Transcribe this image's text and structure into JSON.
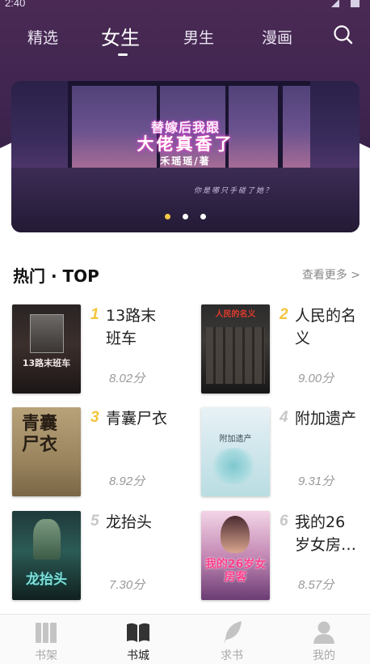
{
  "status_bar": {
    "time": "2:40"
  },
  "top_nav": {
    "tabs": [
      {
        "label": "精选",
        "active": false
      },
      {
        "label": "女生",
        "active": true
      },
      {
        "label": "男生",
        "active": false
      },
      {
        "label": "漫画",
        "active": false
      }
    ],
    "search_icon": "search-icon"
  },
  "banner": {
    "title_line1": "替嫁后我跟",
    "title_line2": "大佬真香了",
    "author": "禾瑶瑶/著",
    "subtitle": "你是哪只手碰了她？",
    "dots_total": 3,
    "dots_active_index": 0
  },
  "section": {
    "title": "热门 · TOP",
    "more": "查看更多 >"
  },
  "books": [
    {
      "rank": "1",
      "title": "13路末班车",
      "score": "8.02分",
      "cover_text": "13路末班车"
    },
    {
      "rank": "2",
      "title": "人民的名义",
      "score": "9.00分",
      "cover_text": "人民的名义"
    },
    {
      "rank": "3",
      "title": "青囊尸衣",
      "score": "8.92分",
      "cover_text": "青囊尸衣"
    },
    {
      "rank": "4",
      "title": "附加遗产",
      "score": "9.31分",
      "cover_text": "附加遗产"
    },
    {
      "rank": "5",
      "title": "龙抬头",
      "score": "7.30分",
      "cover_text": "龙抬头"
    },
    {
      "rank": "6",
      "title": "我的26岁女房…",
      "score": "8.57分",
      "cover_text": "我的26岁女房客"
    }
  ],
  "bottom_nav": [
    {
      "label": "书架",
      "icon": "bookshelf-icon",
      "active": false
    },
    {
      "label": "书城",
      "icon": "open-book-icon",
      "active": true
    },
    {
      "label": "求书",
      "icon": "feather-icon",
      "active": false
    },
    {
      "label": "我的",
      "icon": "user-icon",
      "active": false
    }
  ],
  "colors": {
    "header_top": "#4a2a54",
    "rank_gold": "#f3c53a",
    "rank_grey": "#c8c8c8",
    "dot_active": "#f7c948"
  }
}
